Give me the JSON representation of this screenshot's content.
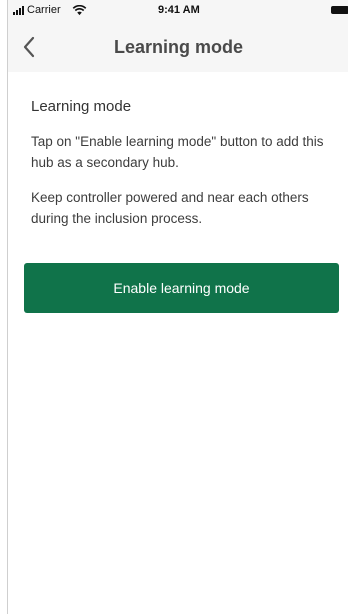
{
  "status_bar": {
    "carrier": "Carrier",
    "time": "9:41 AM"
  },
  "nav": {
    "title": "Learning mode",
    "back_icon": "chevron-left-icon"
  },
  "content": {
    "section_title": "Learning mode",
    "paragraph_1": "Tap on \"Enable learning mode\" button to add this hub as a secondary hub.",
    "paragraph_2": "Keep controller powered and near each others during the inclusion process."
  },
  "actions": {
    "enable_label": "Enable learning mode"
  },
  "colors": {
    "accent": "#10734a",
    "nav_background": "#f6f6f6"
  }
}
